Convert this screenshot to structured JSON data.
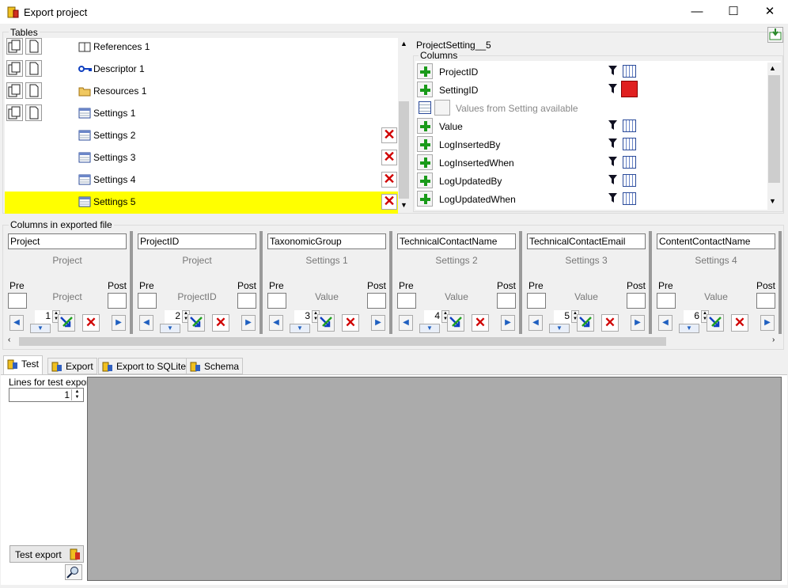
{
  "window": {
    "title": "Export project",
    "minimize": "—",
    "maximize": "☐",
    "close": "✕"
  },
  "tables_group": {
    "label": "Tables",
    "items": [
      {
        "label": "References 1",
        "icon": "book-icon",
        "copy_buttons": true,
        "deletable": false,
        "selected": false
      },
      {
        "label": "Descriptor 1",
        "icon": "key-icon",
        "copy_buttons": true,
        "deletable": false,
        "selected": false
      },
      {
        "label": "Resources 1",
        "icon": "folder-icon",
        "copy_buttons": true,
        "deletable": false,
        "selected": false
      },
      {
        "label": "Settings 1",
        "icon": "table-icon",
        "copy_buttons": true,
        "deletable": false,
        "selected": false
      },
      {
        "label": "Settings 2",
        "icon": "table-icon",
        "copy_buttons": false,
        "deletable": true,
        "selected": false
      },
      {
        "label": "Settings 3",
        "icon": "table-icon",
        "copy_buttons": false,
        "deletable": true,
        "selected": false
      },
      {
        "label": "Settings 4",
        "icon": "table-icon",
        "copy_buttons": false,
        "deletable": true,
        "selected": false
      },
      {
        "label": "Settings 5",
        "icon": "table-icon",
        "copy_buttons": false,
        "deletable": true,
        "selected": true
      }
    ],
    "selected_color": "#ffff00"
  },
  "detail": {
    "table_name": "ProjectSetting__5",
    "columns_label": "Columns",
    "columns": [
      {
        "label": "ProjectID",
        "filter_active": false
      },
      {
        "label": "SettingID",
        "filter_active": true
      },
      {
        "label": "Value",
        "filter_active": false
      },
      {
        "label": "LogInsertedBy",
        "filter_active": false
      },
      {
        "label": "LogInsertedWhen",
        "filter_active": false
      },
      {
        "label": "LogUpdatedBy",
        "filter_active": false
      },
      {
        "label": "LogUpdatedWhen",
        "filter_active": false
      }
    ],
    "values_hint": "Values from Setting available"
  },
  "exported": {
    "label": "Columns in exported file",
    "pre_label": "Pre",
    "post_label": "Post",
    "columns": [
      {
        "name": "Project",
        "source": "Project",
        "value": "Project",
        "pos": "1"
      },
      {
        "name": "ProjectID",
        "source": "Project",
        "value": "ProjectID",
        "pos": "2"
      },
      {
        "name": "TaxonomicGroup",
        "source": "Settings 1",
        "value": "Value",
        "pos": "3"
      },
      {
        "name": "TechnicalContactName",
        "source": "Settings 2",
        "value": "Value",
        "pos": "4"
      },
      {
        "name": "TechnicalContactEmail",
        "source": "Settings 3",
        "value": "Value",
        "pos": "5"
      },
      {
        "name": "ContentContactName",
        "source": "Settings 4",
        "value": "Value",
        "pos": "6"
      }
    ]
  },
  "tabs": {
    "items": [
      {
        "label": "Test",
        "active": true,
        "icon": "test-icon"
      },
      {
        "label": "Export",
        "active": false,
        "icon": "export-icon"
      },
      {
        "label": "Export to SQLite",
        "active": false,
        "icon": "sqlite-icon"
      },
      {
        "label": "Schema",
        "active": false,
        "icon": "schema-icon"
      }
    ]
  },
  "test_panel": {
    "lines_label": "Lines for test export:",
    "lines_value": "1",
    "test_button": "Test export"
  }
}
